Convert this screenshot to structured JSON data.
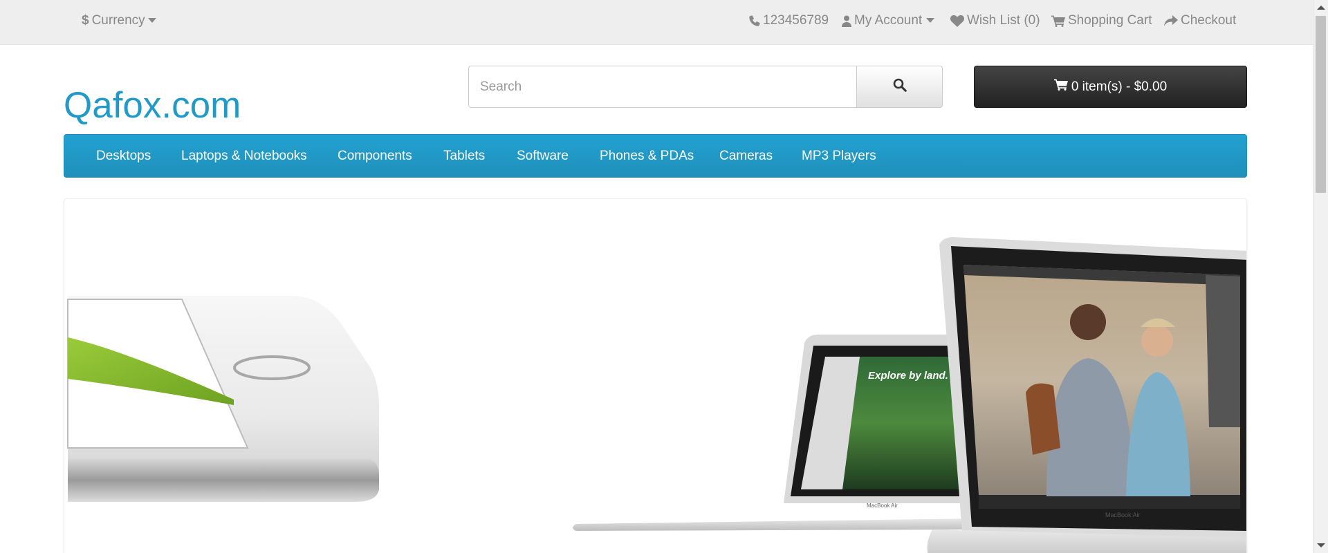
{
  "topbar": {
    "currency_label": "Currency",
    "phone": "123456789",
    "my_account": "My Account",
    "wish_list": "Wish List (0)",
    "shopping_cart": "Shopping Cart",
    "checkout": "Checkout"
  },
  "header": {
    "logo": "Qafox.com",
    "search_placeholder": "Search",
    "search_value": "",
    "cart_button": "0 item(s) - $0.00"
  },
  "menu": {
    "items": [
      {
        "label": "Desktops"
      },
      {
        "label": "Laptops & Notebooks"
      },
      {
        "label": "Components"
      },
      {
        "label": "Tablets"
      },
      {
        "label": "Software"
      },
      {
        "label": "Phones & PDAs"
      },
      {
        "label": "Cameras"
      },
      {
        "label": "MP3 Players"
      }
    ]
  },
  "slideshow": {
    "laptop_brand_label": "MacBook Air",
    "screen_caption": "Explore by land."
  },
  "colors": {
    "brand": "#229ac8",
    "menu_bg": "#229ac8",
    "cart_bg": "#333333",
    "topbar_bg": "#eeeeee"
  },
  "icons": [
    "currency-dollar-icon",
    "caret-down-icon",
    "phone-icon",
    "user-icon",
    "heart-icon",
    "cart-icon",
    "share-icon",
    "search-icon"
  ]
}
